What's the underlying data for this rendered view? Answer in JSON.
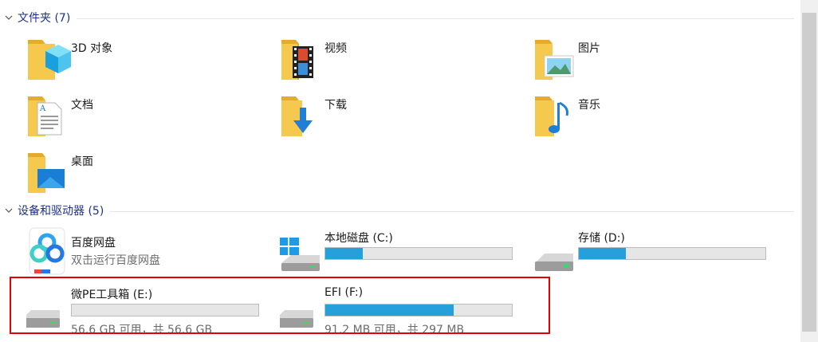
{
  "groups": {
    "folders": {
      "title": "文件夹 (7)"
    },
    "devices": {
      "title": "设备和驱动器 (5)"
    }
  },
  "folders": [
    {
      "label": "3D 对象",
      "icon": "3d-objects-folder-icon"
    },
    {
      "label": "视频",
      "icon": "videos-folder-icon"
    },
    {
      "label": "图片",
      "icon": "pictures-folder-icon"
    },
    {
      "label": "文档",
      "icon": "documents-folder-icon"
    },
    {
      "label": "下载",
      "icon": "downloads-folder-icon"
    },
    {
      "label": "音乐",
      "icon": "music-folder-icon"
    },
    {
      "label": "桌面",
      "icon": "desktop-folder-icon"
    }
  ],
  "app_drive": {
    "name": "百度网盘",
    "subtitle": "双击运行百度网盘",
    "icon": "baidu-netdisk-icon"
  },
  "drives": {
    "c": {
      "name": "本地磁盘 (C:)",
      "free_text": "",
      "used_fraction": 0.2
    },
    "d": {
      "name": "存储 (D:)",
      "free_text": "",
      "used_fraction": 0.25
    },
    "e": {
      "name": "微PE工具箱 (E:)",
      "free_text": "56.6 GB 可用，共 56.6 GB",
      "used_fraction": 0.0
    },
    "f": {
      "name": "EFI (F:)",
      "free_text": "91.2 MB 可用，共 297 MB",
      "used_fraction": 0.69
    }
  },
  "colors": {
    "accent": "#26a0da",
    "highlight": "#e60000",
    "group_title": "#1e3287",
    "folder": "#f5c94d"
  }
}
